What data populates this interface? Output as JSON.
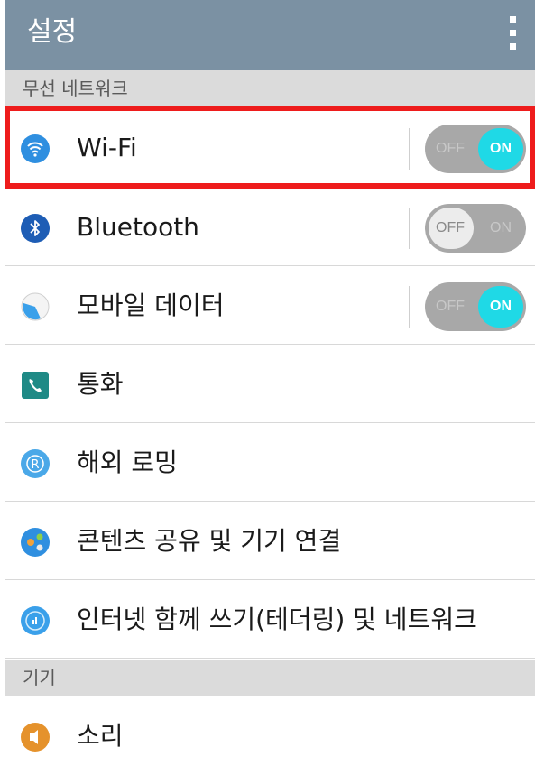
{
  "appbar": {
    "title": "설정",
    "menu_icon": "more-vert-icon"
  },
  "sections": {
    "wireless": "무선 네트워크",
    "device": "기기"
  },
  "rows": {
    "wifi": {
      "label": "Wi-Fi",
      "icon": "wifi-icon",
      "toggle": {
        "off": "OFF",
        "on": "ON",
        "state": "on"
      }
    },
    "bluetooth": {
      "label": "Bluetooth",
      "icon": "bluetooth-icon",
      "toggle": {
        "off": "OFF",
        "on": "ON",
        "state": "off"
      }
    },
    "mobile_data": {
      "label": "모바일 데이터",
      "icon": "mobile-data-icon",
      "toggle": {
        "off": "OFF",
        "on": "ON",
        "state": "on"
      }
    },
    "call": {
      "label": "통화",
      "icon": "phone-icon"
    },
    "roaming": {
      "label": "해외 로밍",
      "icon": "roaming-icon"
    },
    "share_connect": {
      "label": "콘텐츠 공유 및 기기 연결",
      "icon": "share-connect-icon"
    },
    "tethering": {
      "label": "인터넷 함께 쓰기(테더링) 및 네트워크",
      "icon": "tethering-icon"
    },
    "sound": {
      "label": "소리",
      "icon": "sound-icon"
    }
  },
  "colors": {
    "appbar": "#7b91a3",
    "toggle_on": "#1fd9e6",
    "highlight": "#ee1c1c"
  }
}
